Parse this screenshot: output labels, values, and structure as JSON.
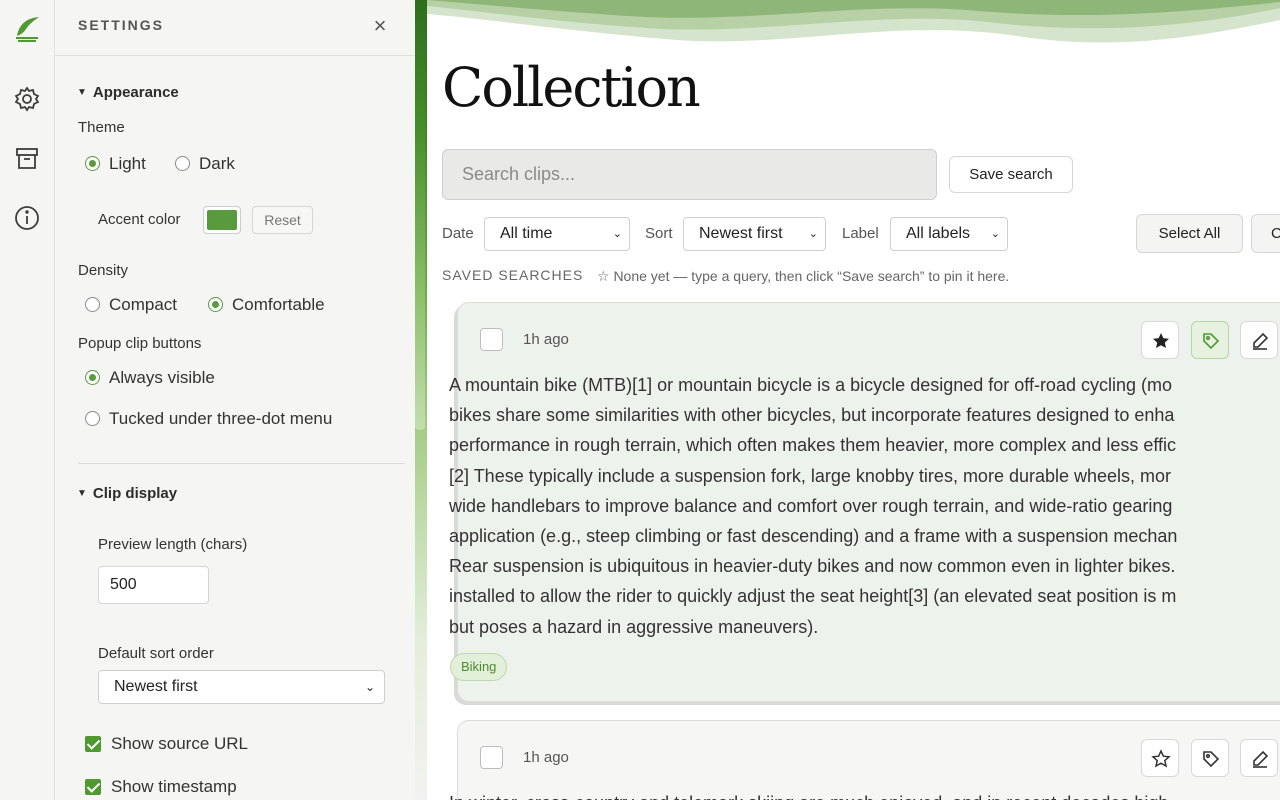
{
  "settings": {
    "title": "SETTINGS",
    "close": "×",
    "appearance": {
      "heading": "Appearance",
      "theme_label": "Theme",
      "theme_options": [
        "Light",
        "Dark"
      ],
      "theme_selected": "Light",
      "accent_label": "Accent color",
      "accent_color": "#5a9a3e",
      "reset_label": "Reset",
      "density_label": "Density",
      "density_options": [
        "Compact",
        "Comfortable"
      ],
      "density_selected": "Comfortable",
      "popup_label": "Popup clip buttons",
      "popup_options": [
        "Always visible",
        "Tucked under three-dot menu"
      ],
      "popup_selected": "Always visible"
    },
    "clip_display": {
      "heading": "Clip display",
      "preview_label": "Preview length (chars)",
      "preview_value": "500",
      "sort_label": "Default sort order",
      "sort_value": "Newest first",
      "show_source": "Show source URL",
      "show_timestamp": "Show timestamp"
    }
  },
  "rail": {
    "icons": [
      "logo-leaf",
      "gear",
      "archive",
      "info"
    ]
  },
  "main": {
    "title": "Collection",
    "search_placeholder": "Search clips...",
    "save_search": "Save search",
    "filters": {
      "date_label": "Date",
      "date_value": "All time",
      "sort_label": "Sort",
      "sort_value": "Newest first",
      "label_label": "Label",
      "label_value": "All labels"
    },
    "select_all": "Select All",
    "clear_partial": "C",
    "saved_heading": "SAVED SEARCHES",
    "saved_text": "☆ None yet — type a query, then click “Save search” to pin it here.",
    "clips": [
      {
        "time": "1h ago",
        "lines": [
          "A mountain bike (MTB)[1] or mountain bicycle is a bicycle designed for off-road cycling (mo",
          "bikes share some similarities with other bicycles, but incorporate features designed to enha",
          "performance in rough terrain, which often makes them heavier, more complex and less effic",
          "[2] These typically include a suspension fork, large knobby tires, more durable wheels, mor",
          "wide handlebars to improve balance and comfort over rough terrain, and wide-ratio gearing",
          "application (e.g., steep climbing or fast descending) and a frame with a suspension mechan",
          "Rear suspension is ubiquitous in heavier-duty bikes and now common even in lighter bikes.",
          "installed to allow the rider to quickly adjust the seat height[3] (an elevated seat position is m",
          "but poses a hazard in aggressive maneuvers)."
        ],
        "tag": "Biking",
        "starred": true
      },
      {
        "time": "1h ago",
        "lines": [
          "In winter, cross-country and telemark skiing are much enjoyed, and in recent decades high"
        ],
        "starred": false
      }
    ]
  },
  "colors": {
    "accent": "#5a9a3e",
    "panel_bg": "#f5f5f4",
    "card_active": "#eef2ec"
  }
}
